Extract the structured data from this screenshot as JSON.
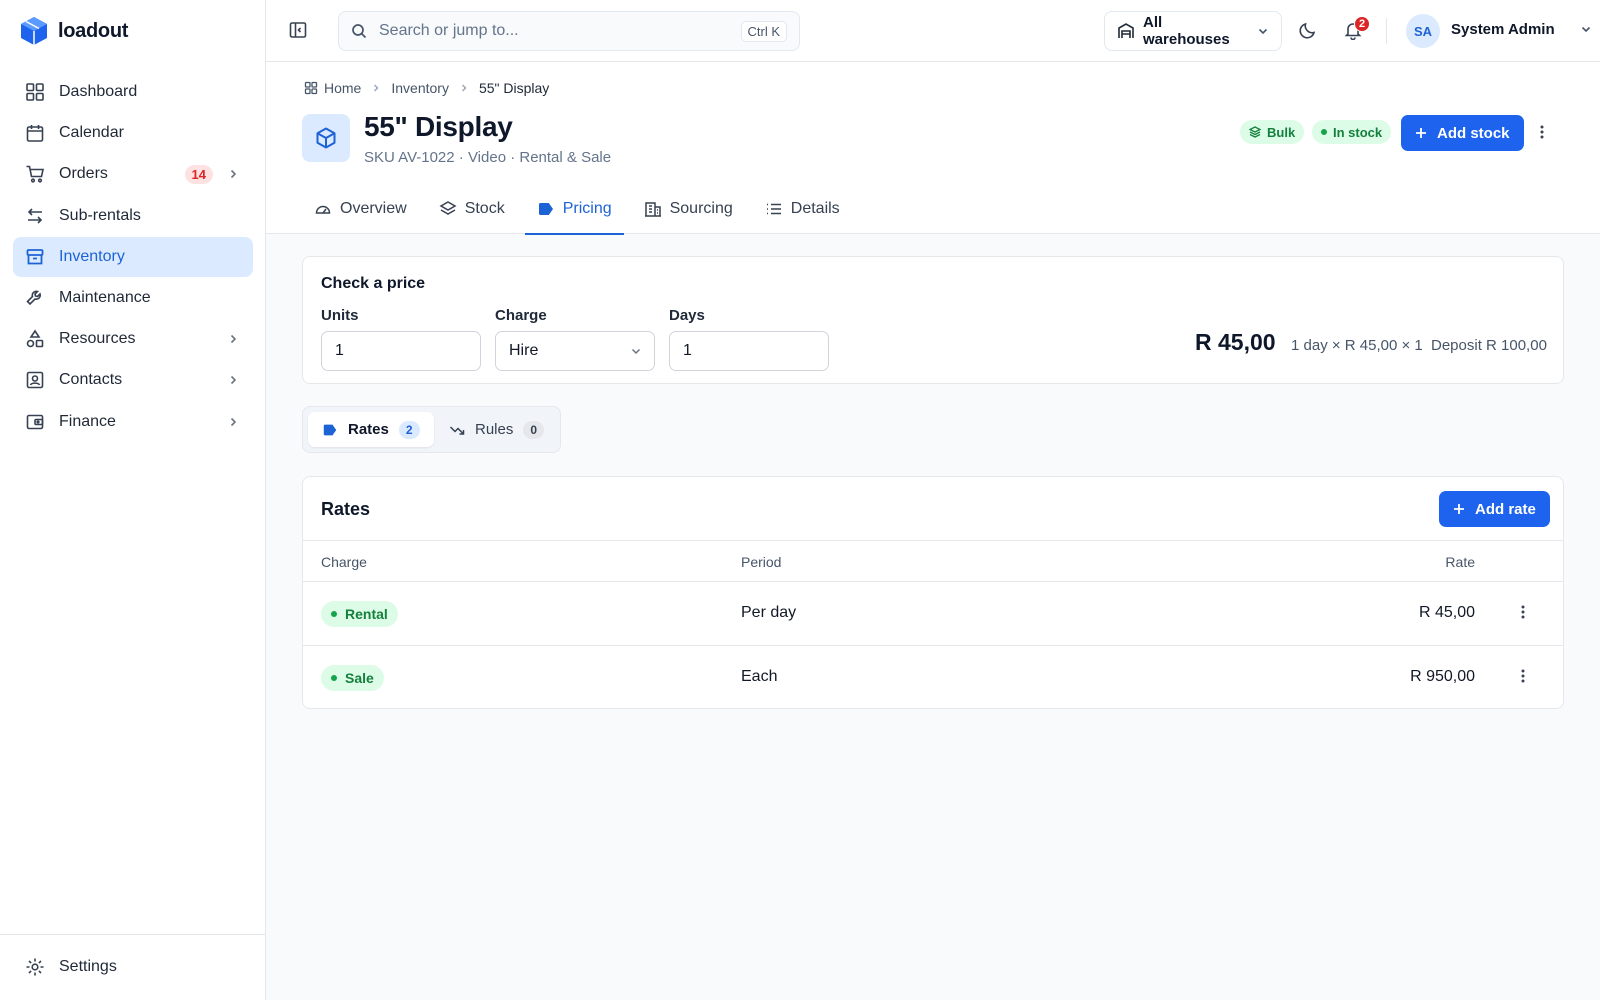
{
  "brand": {
    "name": "loadout"
  },
  "sidebar": {
    "items": [
      {
        "label": "Dashboard",
        "icon": "grid-icon"
      },
      {
        "label": "Calendar",
        "icon": "calendar-icon"
      },
      {
        "label": "Orders",
        "icon": "cart-icon",
        "badge": "14"
      },
      {
        "label": "Sub-rentals",
        "icon": "arrows-icon"
      },
      {
        "label": "Inventory",
        "icon": "box-icon",
        "active": true
      },
      {
        "label": "Maintenance",
        "icon": "wrench-icon"
      },
      {
        "label": "Resources",
        "icon": "shapes-icon"
      },
      {
        "label": "Contacts",
        "icon": "contact-card-icon"
      },
      {
        "label": "Finance",
        "icon": "wallet-icon"
      }
    ],
    "settings_label": "Settings"
  },
  "topbar": {
    "search_placeholder": "Search or jump to...",
    "search_shortcut": "Ctrl K",
    "warehouse": "All warehouses",
    "notifications_count": "2",
    "user_initials": "SA",
    "user_name": "System Admin"
  },
  "breadcrumb": {
    "home": "Home",
    "section": "Inventory",
    "current": "55\" Display"
  },
  "product": {
    "title": "55\" Display",
    "subtitle": "SKU AV-1022 · Video · Rental & Sale",
    "badge_bulk": "Bulk",
    "badge_stock": "In stock",
    "add_stock_label": "Add stock"
  },
  "tabs": [
    {
      "label": "Overview"
    },
    {
      "label": "Stock"
    },
    {
      "label": "Pricing",
      "active": true
    },
    {
      "label": "Sourcing"
    },
    {
      "label": "Details"
    }
  ],
  "price_check": {
    "title": "Check a price",
    "units_label": "Units",
    "units_value": "1",
    "charge_label": "Charge",
    "charge_value": "Hire",
    "days_label": "Days",
    "days_value": "1",
    "total": "R 45,00",
    "breakdown": "1 day × R 45,00 × 1",
    "deposit": "Deposit R 100,00"
  },
  "segments": {
    "rates_label": "Rates",
    "rates_count": "2",
    "rules_label": "Rules",
    "rules_count": "0"
  },
  "rates": {
    "title": "Rates",
    "add_label": "Add rate",
    "headers": {
      "charge": "Charge",
      "period": "Period",
      "rate": "Rate"
    },
    "rows": [
      {
        "charge": "Rental",
        "period": "Per day",
        "rate": "R 45,00"
      },
      {
        "charge": "Sale",
        "period": "Each",
        "rate": "R 950,00"
      }
    ]
  },
  "colors": {
    "accent": "#1d63ed",
    "success": "#15803d",
    "danger": "#dc2626"
  }
}
